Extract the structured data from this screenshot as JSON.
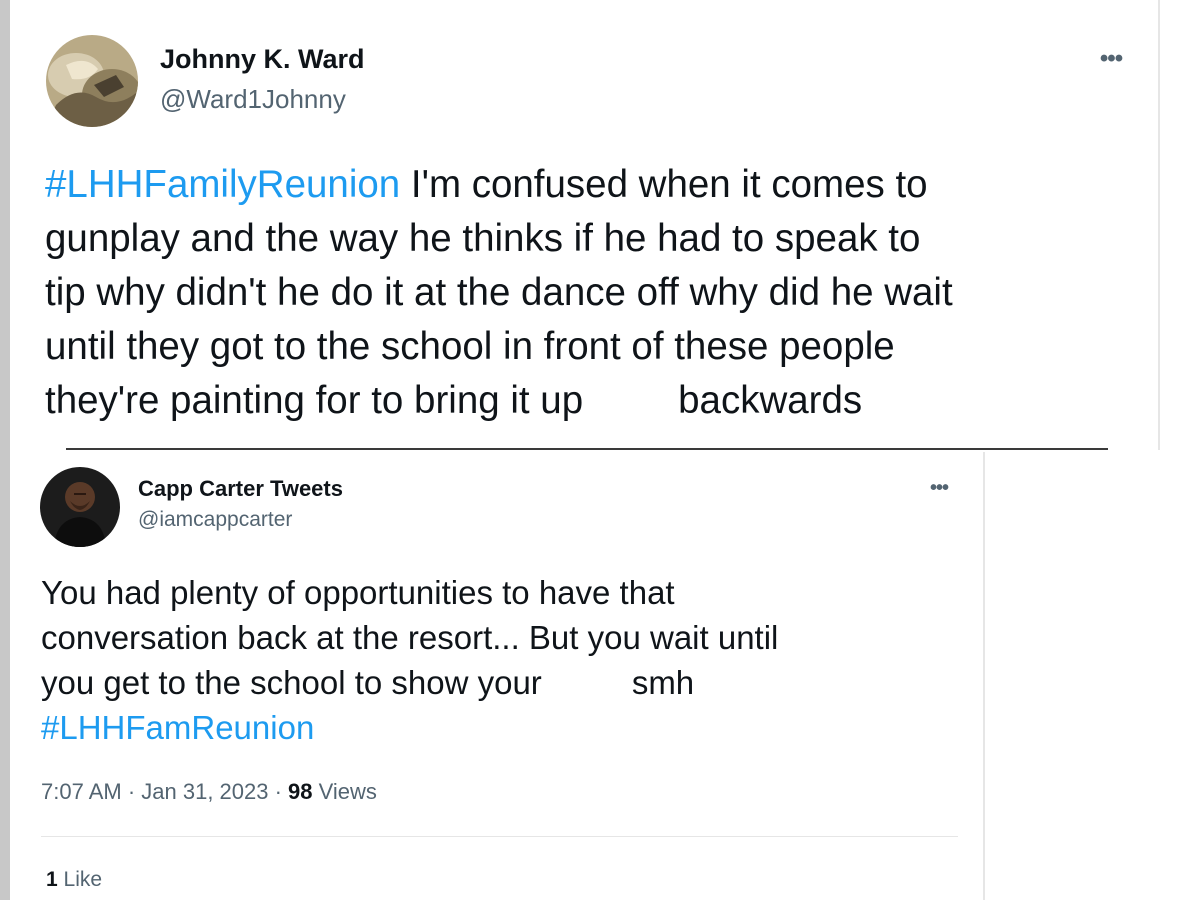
{
  "tweet1": {
    "display_name": "Johnny K. Ward",
    "handle": "@Ward1Johnny",
    "more_icon": "•••",
    "hashtag": "#LHHFamilyReunion",
    "line1": " I'm confused when it comes to",
    "line2": "gunplay and the way he thinks if he had to speak to",
    "line3": "tip why didn't he do it at the dance off why did he wait",
    "line4": "until they got to the school in front of these people",
    "line5a": "they're painting for to bring it up",
    "line5b": "backwards"
  },
  "tweet2": {
    "display_name": "Capp Carter Tweets",
    "handle": "@iamcappcarter",
    "more_icon": "•••",
    "line1": "You had plenty of opportunities to have that",
    "line2": "conversation back at the resort... But you wait until",
    "line3a": "you get to the school to show your",
    "line3b": "smh",
    "hashtag": "#LHHFamReunion",
    "timestamp": "7:07 AM · Jan 31, 2023 · ",
    "views_count": "98",
    "views_label": " Views",
    "likes_count": "1",
    "likes_label": " Like"
  },
  "colors": {
    "text": "#0f1419",
    "secondary": "#536471",
    "link": "#1d9bf0"
  }
}
